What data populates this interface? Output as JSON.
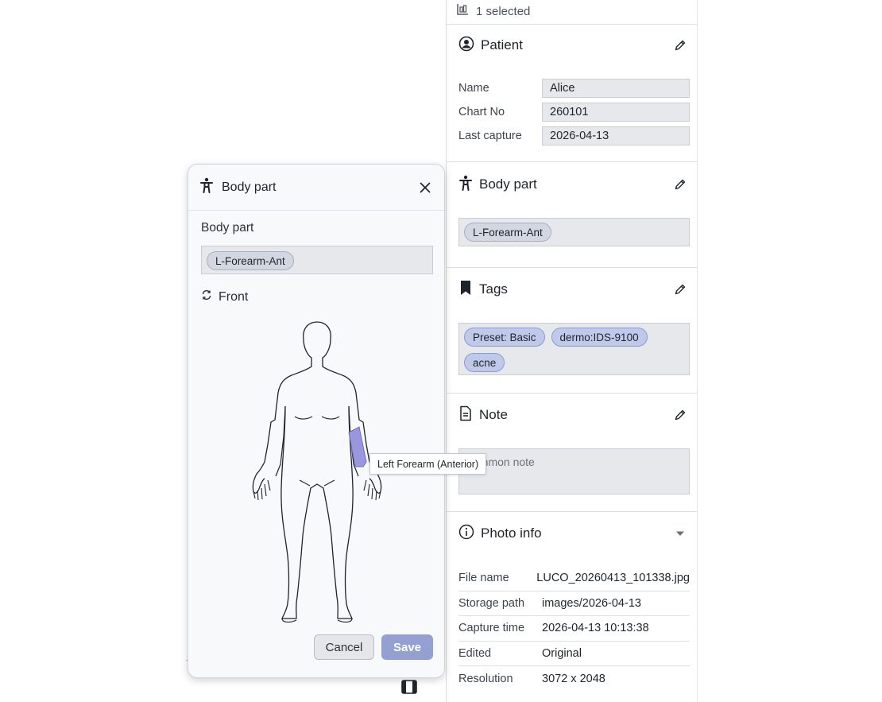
{
  "selection": {
    "label": "1 selected"
  },
  "patient": {
    "title": "Patient",
    "fields": [
      {
        "label": "Name",
        "value": "Alice"
      },
      {
        "label": "Chart No",
        "value": "260101"
      },
      {
        "label": "Last capture",
        "value": "2026-04-13"
      }
    ]
  },
  "body_part_section": {
    "title": "Body part",
    "chips": [
      "L-Forearm-Ant"
    ]
  },
  "tags_section": {
    "title": "Tags",
    "chips": [
      "Preset: Basic",
      "dermo:IDS-9100",
      "acne"
    ]
  },
  "note_section": {
    "title": "Note",
    "placeholder": "common note"
  },
  "photo_info": {
    "title": "Photo info",
    "rows": [
      {
        "label": "File name",
        "value": "LUCO_20260413_101338.jpg"
      },
      {
        "label": "Storage path",
        "value": "images/2026-04-13"
      },
      {
        "label": "Capture time",
        "value": "2026-04-13 10:13:38"
      },
      {
        "label": "Edited",
        "value": "Original"
      },
      {
        "label": "Resolution",
        "value": "3072 x 2048"
      }
    ]
  },
  "modal": {
    "title": "Body part",
    "field_label": "Body part",
    "chips": [
      "L-Forearm-Ant"
    ],
    "view_label": "Front",
    "tooltip": "Left Forearm (Anterior)",
    "cancel_label": "Cancel",
    "save_label": "Save",
    "highlight_color": "#9b97de"
  },
  "colors": {
    "chip_fill": "#bfc9ea",
    "save_button": "#95a0d2"
  }
}
